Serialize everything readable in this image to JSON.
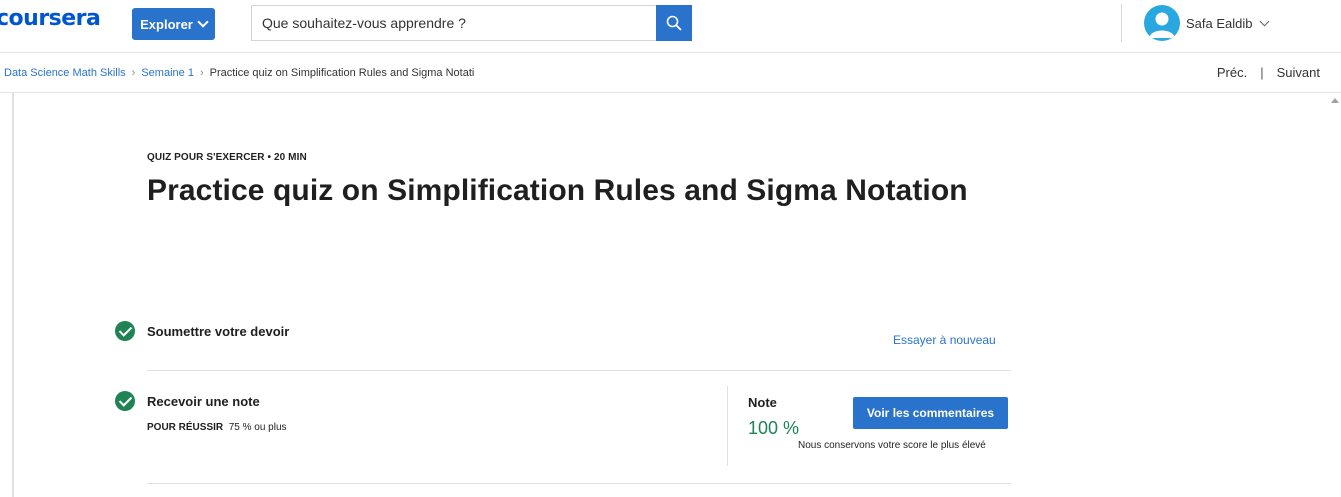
{
  "header": {
    "logo_text": "coursera",
    "explore_label": "Explorer",
    "search_placeholder": "Que souhaitez-vous apprendre ?",
    "user_name": "Safa Ealdib"
  },
  "breadcrumb": {
    "items": [
      "Data Science Math Skills",
      "Semaine 1"
    ],
    "current": "Practice quiz on Simplification Rules and Sigma Notati",
    "prev_label": "Préc.",
    "divider": "|",
    "next_label": "Suivant"
  },
  "quiz": {
    "eyebrow": "QUIZ POUR S'EXERCER • 20  MIN",
    "title": "Practice quiz on Simplification Rules and Sigma Notation"
  },
  "steps": {
    "submit_label": "Soumettre votre devoir",
    "retry_label": "Essayer à nouveau",
    "receive_label": "Recevoir une note",
    "pass_label": "POUR RÉUSSIR",
    "pass_value": "75 % ou plus",
    "grade_label": "Note",
    "grade_value": "100 %",
    "feedback_label": "Voir les commentaires",
    "keep_note": "Nous conservons votre score le plus élevé"
  },
  "colors": {
    "accent": "#2a73cc",
    "brand": "#0056d2",
    "success": "#1f8354"
  },
  "icons": [
    "search-icon",
    "chevron-down-icon",
    "avatar-icon",
    "check-circle-icon",
    "chevron-right-icon"
  ]
}
